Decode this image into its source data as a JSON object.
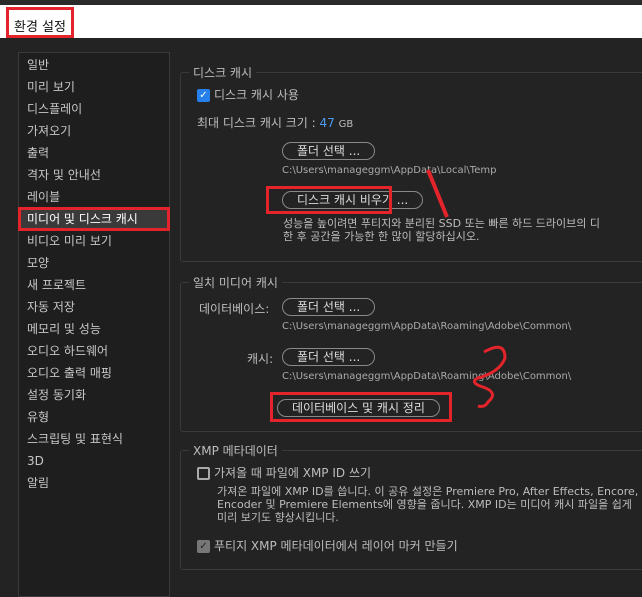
{
  "window": {
    "title": "환경 설정"
  },
  "sidebar": {
    "items": [
      "일반",
      "미리 보기",
      "디스플레이",
      "가져오기",
      "출력",
      "격자 및 안내선",
      "레이블",
      "미디어 및 디스크 캐시",
      "비디오 미리 보기",
      "모양",
      "새 프로젝트",
      "자동 저장",
      "메모리 및 성능",
      "오디오 하드웨어",
      "오디오 출력 매핑",
      "설정 동기화",
      "유형",
      "스크립팅 및 표현식",
      "3D",
      "알림"
    ],
    "selected": 7
  },
  "disk_cache": {
    "legend": "디스크 캐시",
    "enable_label": "디스크 캐시 사용",
    "enable_checked": true,
    "max_size_label": "최대 디스크 캐시 크기 :",
    "max_size_value": "47",
    "max_size_unit": "GB",
    "folder_button": "폴더 선택 ...",
    "path": "C:\\Users\\manageggm\\AppData\\Local\\Temp",
    "clear_button": "디스크 캐시 비우기 ...",
    "hint_line1": "성능을 높이려면 푸티지와 분리된 SSD 또는 빠른 하드 드라이브의 디",
    "hint_line2": "한 후 공간을 가능한 한 많이 할당하십시오."
  },
  "media_cache": {
    "legend": "일치 미디어 캐시",
    "db_label": "데이터베이스:",
    "db_button": "폴더 선택 ...",
    "db_path": "C:\\Users\\manageggm\\AppData\\Roaming\\Adobe\\Common\\",
    "cache_label": "캐시:",
    "cache_button": "폴더 선택 ...",
    "cache_path": "C:\\Users\\manageggm\\AppData\\Roaming\\Adobe\\Common\\",
    "clean_button": "데이터베이스 및 캐시 정리"
  },
  "xmp": {
    "legend": "XMP 메타데이터",
    "write_label": "가져올 때 파일에 XMP ID 쓰기",
    "write_checked": false,
    "desc_line1": "가져온 파일에 XMP ID를 씁니다. 이 공유 설정은 Premiere Pro, After Effects, Encore, Au",
    "desc_line2": "Encoder 및 Premiere Elements에 영향을 줍니다. XMP ID는 미디어 캐시 파일을 쉽게",
    "desc_line3": "미리 보기도 향상시킵니다.",
    "markers_label": "푸티지 XMP 메타데이터에서 레이어 마커 만들기",
    "markers_checked": true
  },
  "colors": {
    "accent": "#2680eb",
    "annotation": "#e3242b"
  }
}
